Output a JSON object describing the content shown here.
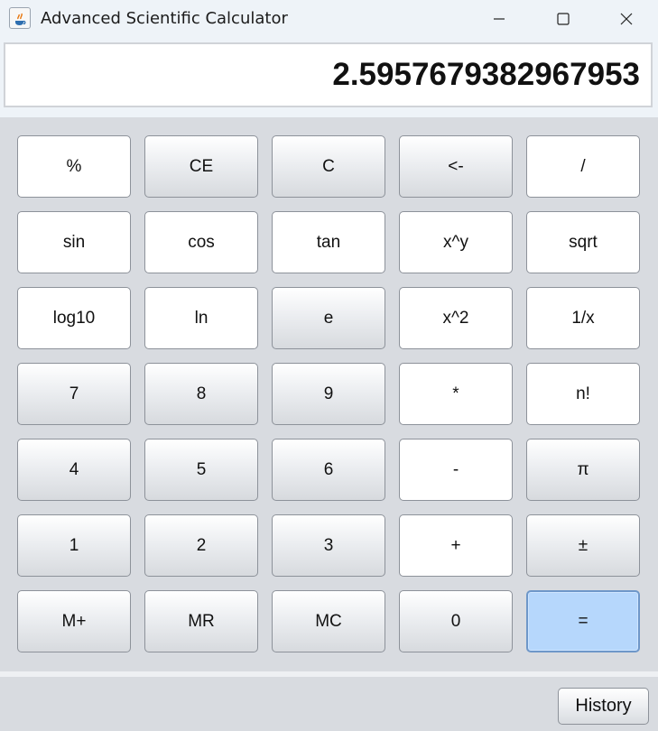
{
  "window": {
    "title": "Advanced Scientific Calculator",
    "controls": [
      "minimize-icon",
      "maximize-icon",
      "close-icon"
    ]
  },
  "display": {
    "value": "2.5957679382967953"
  },
  "keys": [
    [
      "%",
      "CE",
      "C",
      "<-",
      "/"
    ],
    [
      "sin",
      "cos",
      "tan",
      "x^y",
      "sqrt"
    ],
    [
      "log10",
      "ln",
      "e",
      "x^2",
      "1/x"
    ],
    [
      "7",
      "8",
      "9",
      "*",
      "n!"
    ],
    [
      "4",
      "5",
      "6",
      "-",
      "π"
    ],
    [
      "1",
      "2",
      "3",
      "+",
      "±"
    ],
    [
      "M+",
      "MR",
      "MC",
      "0",
      "="
    ]
  ],
  "footer": {
    "history_label": "History"
  },
  "colors": {
    "equals_key": "#b6d7fc",
    "titlebar": "#eef3f8",
    "panel": "#d8dbe0"
  }
}
